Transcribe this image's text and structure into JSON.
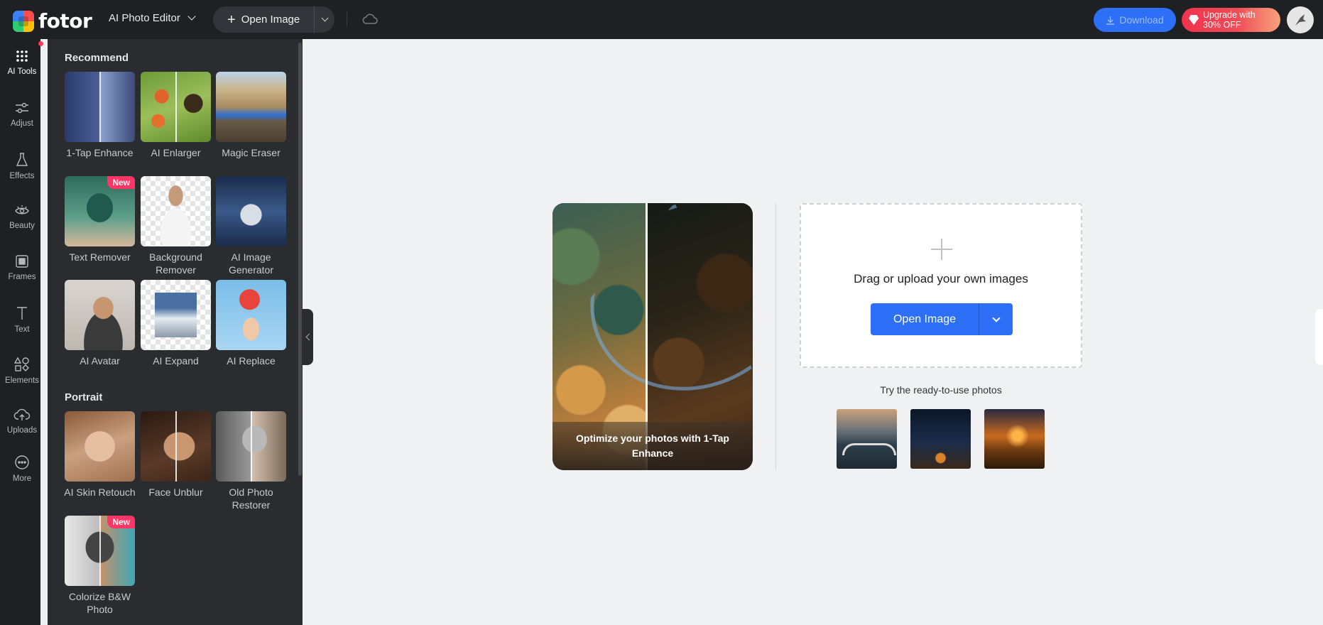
{
  "topbar": {
    "logo_text": "fotor",
    "editor_switch": "AI Photo Editor",
    "open_image": "Open Image",
    "download": "Download",
    "upgrade_line1": "Upgrade with",
    "upgrade_line2": "30% OFF"
  },
  "rail": {
    "items": [
      {
        "label": "AI Tools",
        "icon": "grid-icon"
      },
      {
        "label": "Adjust",
        "icon": "sliders-icon"
      },
      {
        "label": "Effects",
        "icon": "flask-icon"
      },
      {
        "label": "Beauty",
        "icon": "eye-icon"
      },
      {
        "label": "Frames",
        "icon": "frame-icon"
      },
      {
        "label": "Text",
        "icon": "text-icon"
      },
      {
        "label": "Elements",
        "icon": "shapes-icon"
      },
      {
        "label": "Uploads",
        "icon": "cloud-upload-icon"
      },
      {
        "label": "More",
        "icon": "more-icon"
      }
    ]
  },
  "panel": {
    "recommend_title": "Recommend",
    "portrait_title": "Portrait",
    "badge_new": "New",
    "recommend": [
      {
        "name": "1-Tap Enhance"
      },
      {
        "name": "AI Enlarger"
      },
      {
        "name": "Magic Eraser"
      },
      {
        "name": "Text Remover"
      },
      {
        "name": "Background Remover"
      },
      {
        "name": "AI Image Generator"
      },
      {
        "name": "AI Avatar"
      },
      {
        "name": "AI Expand"
      },
      {
        "name": "AI Replace"
      }
    ],
    "portrait": [
      {
        "name": "AI Skin Retouch"
      },
      {
        "name": "Face Unblur"
      },
      {
        "name": "Old Photo Restorer"
      },
      {
        "name": "Colorize B&W Photo"
      }
    ]
  },
  "main": {
    "preview_caption": "Optimize your photos with 1-Tap Enhance",
    "upload_text": "Drag or upload your own images",
    "open_image": "Open Image",
    "try_label": "Try the ready-to-use photos"
  },
  "colors": {
    "accent": "#2d6ff7",
    "topbar": "#1f2023",
    "panel": "#2b2c30",
    "badge": "#ff3565"
  }
}
